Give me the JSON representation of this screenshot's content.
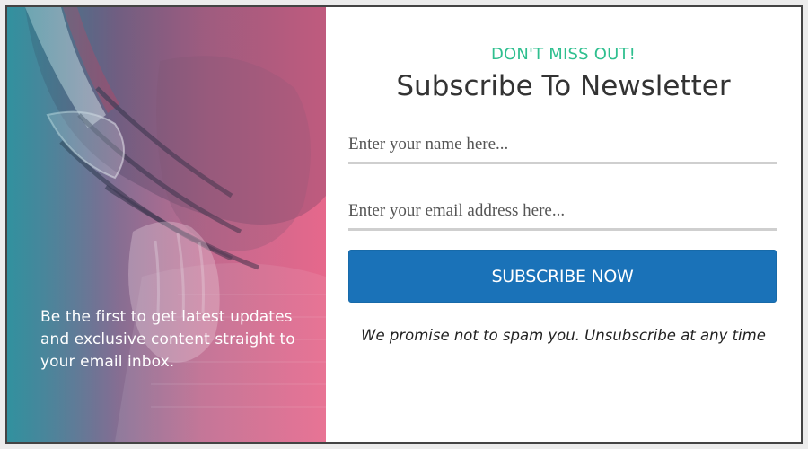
{
  "hero": {
    "image": "football-player-helmet-photo",
    "tagline": "Be the first to get latest updates and exclusive content straight to your email inbox."
  },
  "form": {
    "eyebrow": "DON'T MISS OUT!",
    "title": "Subscribe To Newsletter",
    "name_placeholder": "Enter your name here...",
    "name_value": "",
    "email_placeholder": "Enter your email address here...",
    "email_value": "",
    "submit_label": "SUBSCRIBE NOW",
    "disclaimer": "We promise not to spam you. Unsubscribe at any time"
  },
  "colors": {
    "accent_green": "#2fbf8f",
    "button_blue": "#1a72b8",
    "gradient_teal": "#3d8a9c",
    "gradient_pink": "#e66a8b"
  }
}
